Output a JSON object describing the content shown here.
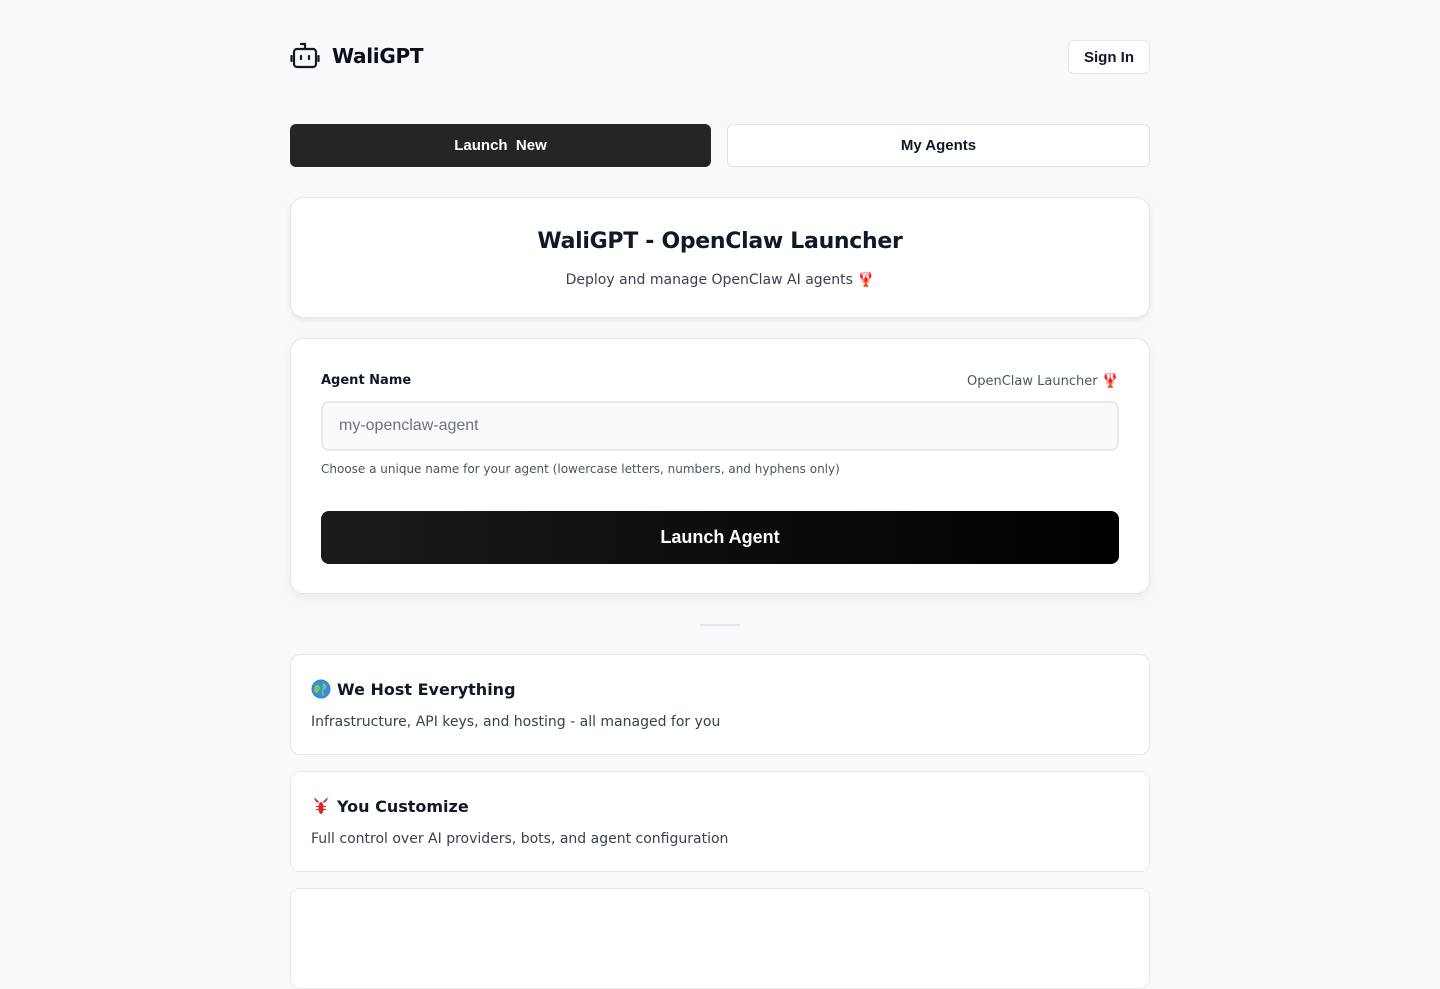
{
  "header": {
    "brand_name": "WaliGPT",
    "sign_in_label": "Sign In"
  },
  "tabs": [
    {
      "label": "Launch  New",
      "active": true
    },
    {
      "label": "My Agents",
      "active": false
    }
  ],
  "hero": {
    "title": "WaliGPT - OpenClaw Launcher",
    "subtitle": "Deploy and manage OpenClaw AI agents",
    "subtitle_emoji": "🦞"
  },
  "form": {
    "field_label": "Agent Name",
    "launcher_tag": "OpenClaw Launcher",
    "launcher_tag_emoji": "🦞",
    "input_value": "",
    "input_placeholder": "my-openclaw-agent",
    "hint": "Choose a unique name for your agent (lowercase letters, numbers, and hyphens only)",
    "submit_label": "Launch Agent"
  },
  "features": [
    {
      "icon": "globe-icon",
      "title": "We Host Everything",
      "description": "Infrastructure, API keys, and hosting - all managed for you"
    },
    {
      "icon": "lobster-icon",
      "title": "You Customize",
      "description": "Full control over AI providers, bots, and agent configuration"
    }
  ],
  "colors": {
    "background": "#f8f9fb",
    "primary_dark": "#242626",
    "button_black": "#000000",
    "lobster_red": "#dc2626",
    "globe_blue": "#2f80c8"
  }
}
